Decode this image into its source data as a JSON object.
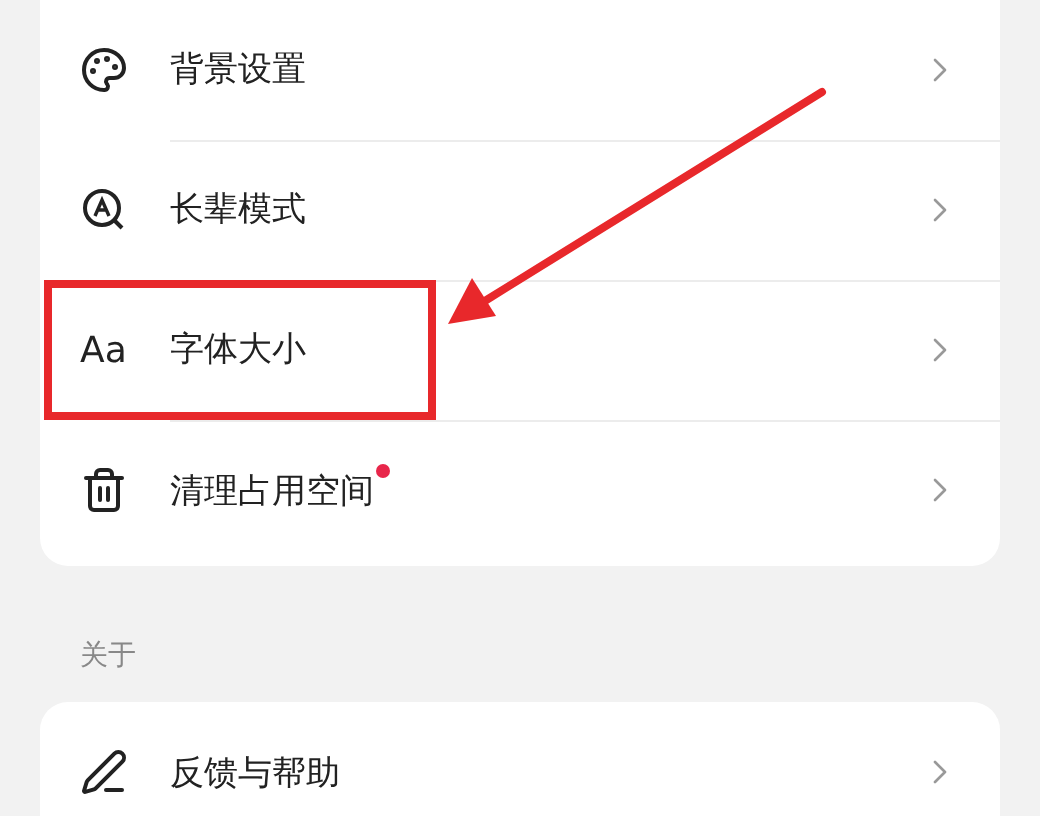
{
  "settings_card": {
    "items": [
      {
        "kind": "icon",
        "label": "背景设置",
        "highlighted": false,
        "badge": false
      },
      {
        "kind": "icon",
        "label": "长辈模式",
        "highlighted": false,
        "badge": false
      },
      {
        "kind": "text-icon",
        "icon_text": "Aa",
        "label": "字体大小",
        "highlighted": true,
        "badge": false
      },
      {
        "kind": "icon",
        "label": "清理占用空间",
        "highlighted": false,
        "badge": true
      }
    ]
  },
  "about_section": {
    "title": "关于",
    "items": [
      {
        "kind": "icon",
        "label": "反馈与帮助",
        "highlighted": false,
        "badge": false
      }
    ]
  }
}
